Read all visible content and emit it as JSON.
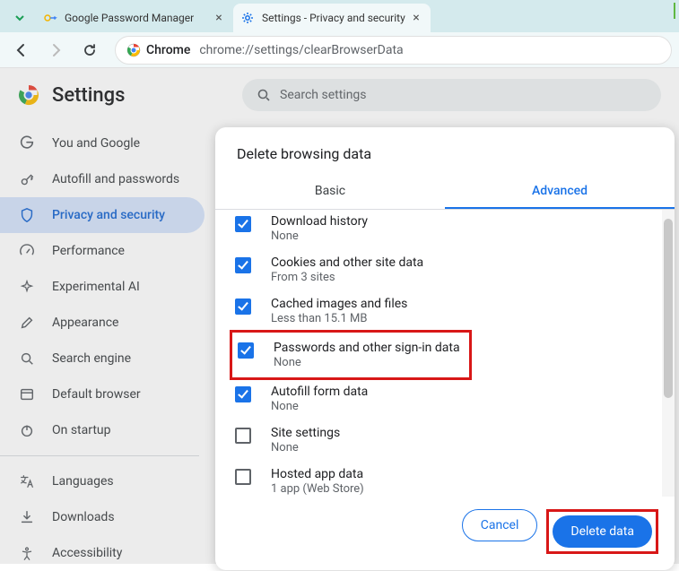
{
  "tabs": {
    "items": [
      {
        "title": "Google Password Manager"
      },
      {
        "title": "Settings - Privacy and security"
      }
    ]
  },
  "omnibox": {
    "chrome_label": "Chrome",
    "url": "chrome://settings/clearBrowserData"
  },
  "settings": {
    "title": "Settings",
    "search_placeholder": "Search settings"
  },
  "sidebar": {
    "items": [
      {
        "label": "You and Google"
      },
      {
        "label": "Autofill and passwords"
      },
      {
        "label": "Privacy and security"
      },
      {
        "label": "Performance"
      },
      {
        "label": "Experimental AI"
      },
      {
        "label": "Appearance"
      },
      {
        "label": "Search engine"
      },
      {
        "label": "Default browser"
      },
      {
        "label": "On startup"
      }
    ],
    "items2": [
      {
        "label": "Languages"
      },
      {
        "label": "Downloads"
      },
      {
        "label": "Accessibility"
      }
    ]
  },
  "dialog": {
    "title": "Delete browsing data",
    "tab_basic": "Basic",
    "tab_advanced": "Advanced",
    "rows": [
      {
        "primary": "Download history",
        "secondary": "None",
        "checked": true
      },
      {
        "primary": "Cookies and other site data",
        "secondary": "From 3 sites",
        "checked": true
      },
      {
        "primary": "Cached images and files",
        "secondary": "Less than 15.1 MB",
        "checked": true
      },
      {
        "primary": "Passwords and other sign-in data",
        "secondary": "None",
        "checked": true
      },
      {
        "primary": "Autofill form data",
        "secondary": "None",
        "checked": true
      },
      {
        "primary": "Site settings",
        "secondary": "None",
        "checked": false
      },
      {
        "primary": "Hosted app data",
        "secondary": "1 app (Web Store)",
        "checked": false
      }
    ],
    "cancel": "Cancel",
    "confirm": "Delete data"
  }
}
